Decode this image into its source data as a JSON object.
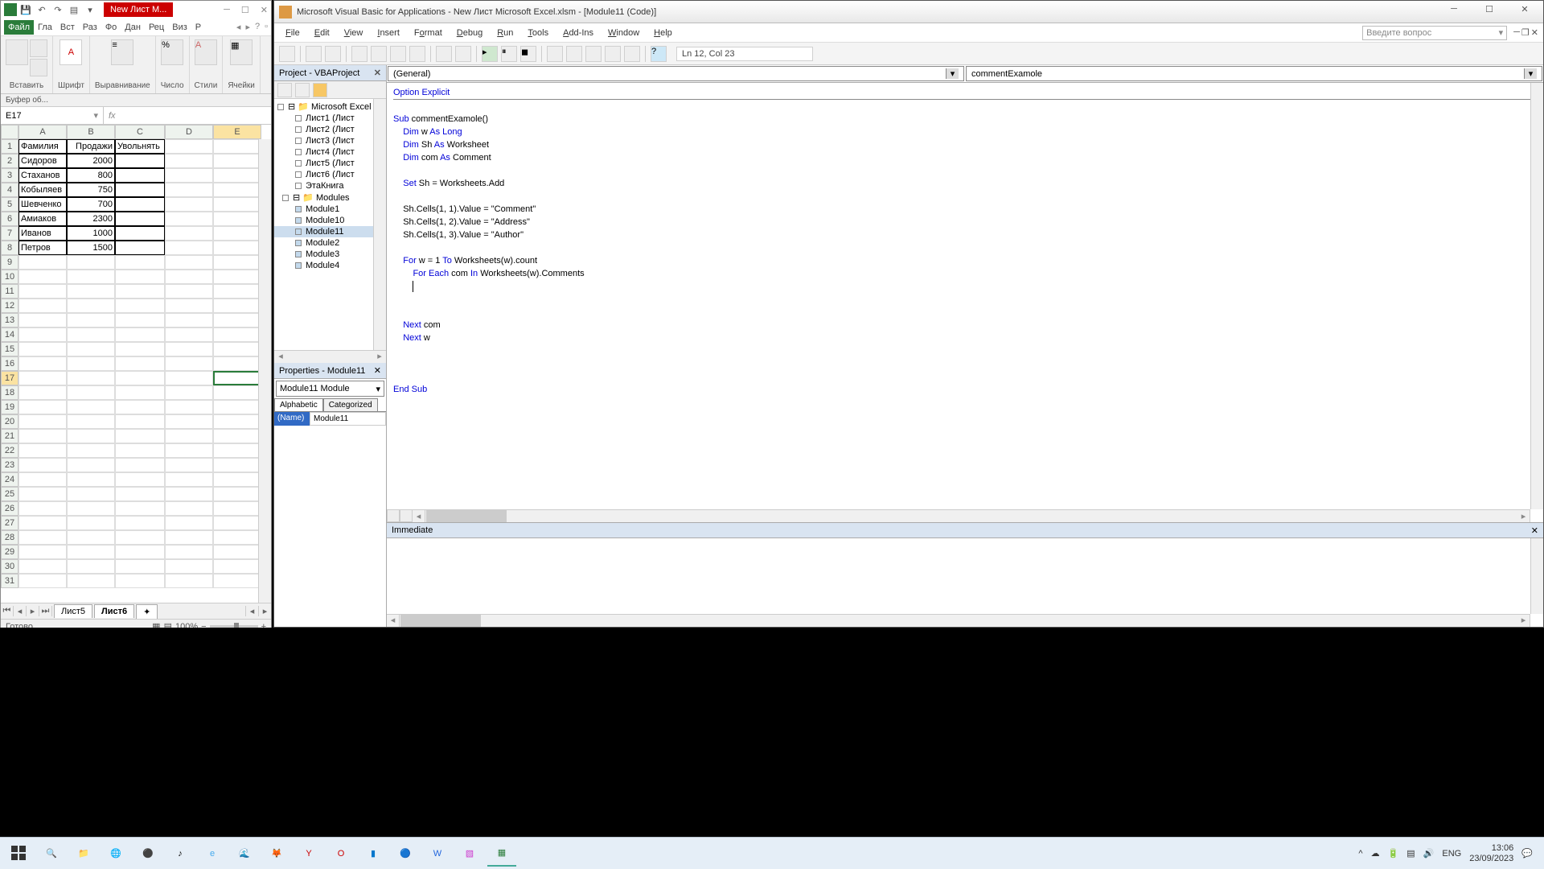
{
  "excel": {
    "doc_tab": "New Лист М...",
    "ribbon_tabs": {
      "file": "Файл",
      "gla": "Гла",
      "vst": "Вст",
      "raz": "Раз",
      "for": "Фо",
      "dan": "Дан",
      "rec": "Рец",
      "viz": "Виз",
      "r": "Р"
    },
    "groups": {
      "clipboard": "Вставить",
      "clipboard2": "Буфер об...",
      "font": "Шрифт",
      "align": "Выравнивание",
      "number": "Число",
      "styles": "Стили",
      "cells": "Ячейки"
    },
    "namebox": "E17",
    "col_headers": [
      "A",
      "B",
      "C",
      "D",
      "E"
    ],
    "row_headers_start": 1,
    "row_count": 31,
    "data": {
      "headers": [
        "Фамилия",
        "Продажи",
        "Увольнять"
      ],
      "rows": [
        [
          "Сидоров",
          "2000",
          ""
        ],
        [
          "Стаханов",
          "800",
          ""
        ],
        [
          "Кобыляев",
          "750",
          ""
        ],
        [
          "Шевченко",
          "700",
          ""
        ],
        [
          "Амиаков",
          "2300",
          ""
        ],
        [
          "Иванов",
          "1000",
          ""
        ],
        [
          "Петров",
          "1500",
          ""
        ]
      ]
    },
    "sheets": {
      "s1": "Лист5",
      "s2": "Лист6"
    },
    "status": "Готово",
    "zoom": "100%"
  },
  "vbe": {
    "title": "Microsoft Visual Basic for Applications - New Лист Microsoft Excel.xlsm - [Module11 (Code)]",
    "menus": {
      "file": "File",
      "edit": "Edit",
      "view": "View",
      "insert": "Insert",
      "format": "Format",
      "debug": "Debug",
      "run": "Run",
      "tools": "Tools",
      "addins": "Add-Ins",
      "window": "Window",
      "help": "Help"
    },
    "help_search": "Введите вопрос",
    "cursor_pos": "Ln 12, Col 23",
    "project_pane": {
      "title": "Project - VBAProject"
    },
    "tree": {
      "root": "Microsoft Excel O",
      "sheets": [
        "Лист1 (Лист",
        "Лист2 (Лист",
        "Лист3 (Лист",
        "Лист4 (Лист",
        "Лист5 (Лист",
        "Лист6 (Лист",
        "ЭтаКнига"
      ],
      "modules_folder": "Modules",
      "modules": [
        "Module1",
        "Module10",
        "Module11",
        "Module2",
        "Module3",
        "Module4"
      ]
    },
    "props": {
      "title": "Properties - Module11",
      "combo": "Module11 Module",
      "tab_alpha": "Alphabetic",
      "tab_cat": "Categorized",
      "name_label": "(Name)",
      "name_value": "Module11"
    },
    "code": {
      "left_combo": "(General)",
      "right_combo": "commentExamole",
      "lines": [
        {
          "t": "Option Explicit",
          "kw": [
            "Option",
            "Explicit"
          ]
        },
        {
          "t": ""
        },
        {
          "t": "Sub commentExamole()",
          "kw": [
            "Sub"
          ]
        },
        {
          "t": "    Dim w As Long",
          "kw": [
            "Dim",
            "As",
            "Long"
          ]
        },
        {
          "t": "    Dim Sh As Worksheet",
          "kw": [
            "Dim",
            "As"
          ]
        },
        {
          "t": "    Dim com As Comment",
          "kw": [
            "Dim",
            "As"
          ]
        },
        {
          "t": ""
        },
        {
          "t": "    Set Sh = Worksheets.Add",
          "kw": [
            "Set"
          ]
        },
        {
          "t": ""
        },
        {
          "t": "    Sh.Cells(1, 1).Value = \"Comment\"",
          "kw": []
        },
        {
          "t": "    Sh.Cells(1, 2).Value = \"Address\"",
          "kw": []
        },
        {
          "t": "    Sh.Cells(1, 3).Value = \"Author\"",
          "kw": []
        },
        {
          "t": ""
        },
        {
          "t": "    For w = 1 To Worksheets(w).count",
          "kw": [
            "For",
            "To"
          ]
        },
        {
          "t": "        For Each com In Worksheets(w).Comments",
          "kw": [
            "For",
            "Each",
            "In"
          ]
        },
        {
          "t": "        |",
          "kw": [],
          "cursor": true
        },
        {
          "t": ""
        },
        {
          "t": ""
        },
        {
          "t": "    Next com",
          "kw": [
            "Next"
          ]
        },
        {
          "t": "    Next w",
          "kw": [
            "Next"
          ]
        },
        {
          "t": ""
        },
        {
          "t": ""
        },
        {
          "t": ""
        },
        {
          "t": "End Sub",
          "kw": [
            "End",
            "Sub"
          ]
        }
      ]
    },
    "immediate_title": "Immediate"
  },
  "taskbar": {
    "lang": "ENG",
    "time": "13:06",
    "date": "23/09/2023"
  }
}
